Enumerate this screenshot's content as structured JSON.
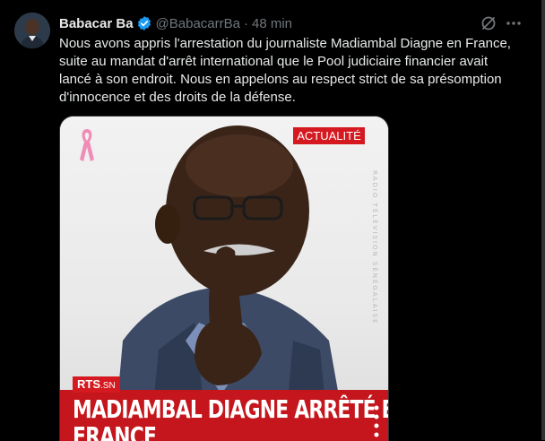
{
  "tweet": {
    "display_name": "Babacar Ba",
    "handle": "@BabacarrBa",
    "separator": "·",
    "time": "48 min",
    "text": "Nous avons appris l'arrestation du journaliste Madiambal Diagne en France,\nsuite au mandat d'arrêt international que le Pool judiciaire financier avait\nlancé à son endroit. Nous en appelons au respect strict de sa présomption\nd'innocence et des droits de la défense."
  },
  "media": {
    "tag": "ACTUALITÉ",
    "vertical_text": "RADIO TÉLÉVISION SÉNÉGALAISE",
    "logo_main": "RTS",
    "logo_suffix": ".SN",
    "headline_line1": "MADIAMBAL DIAGNE ARRÊTÉ EN",
    "headline_line2": "FRANCE"
  },
  "colors": {
    "background": "#000000",
    "text": "#e7e9ea",
    "muted": "#71767b",
    "verified": "#1d9bf0",
    "brand_red": "#d41920"
  },
  "icons": {
    "verified": "verified-badge-icon",
    "grok": "grok-icon",
    "more": "more-options-icon",
    "ribbon": "pink-ribbon-icon"
  }
}
